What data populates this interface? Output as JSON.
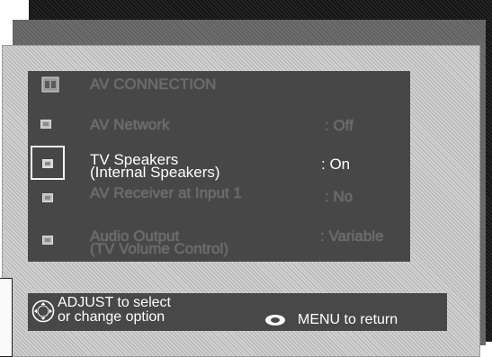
{
  "menu": {
    "header": "AV CONNECTION",
    "items": [
      {
        "label_line1": "AV Network",
        "label_line2": "",
        "value": ": Off"
      },
      {
        "label_line1": "TV Speakers",
        "label_line2": "(Internal Speakers)",
        "value": ": On"
      },
      {
        "label_line1": "AV Receiver at Input 1",
        "label_line2": "",
        "value": ": No"
      },
      {
        "label_line1": "Audio Output",
        "label_line2": "(TV Volume Control)",
        "value": ": Variable"
      }
    ],
    "selected_index": 1
  },
  "hint": {
    "adjust_line1": "ADJUST  to select",
    "adjust_line2": "or change option",
    "menu_return": "MENU to return"
  },
  "icons": {
    "header": "speaker-icon",
    "item": "menu-square-icon",
    "adjust": "dpad-icon",
    "menu_button": "menu-button-icon"
  }
}
